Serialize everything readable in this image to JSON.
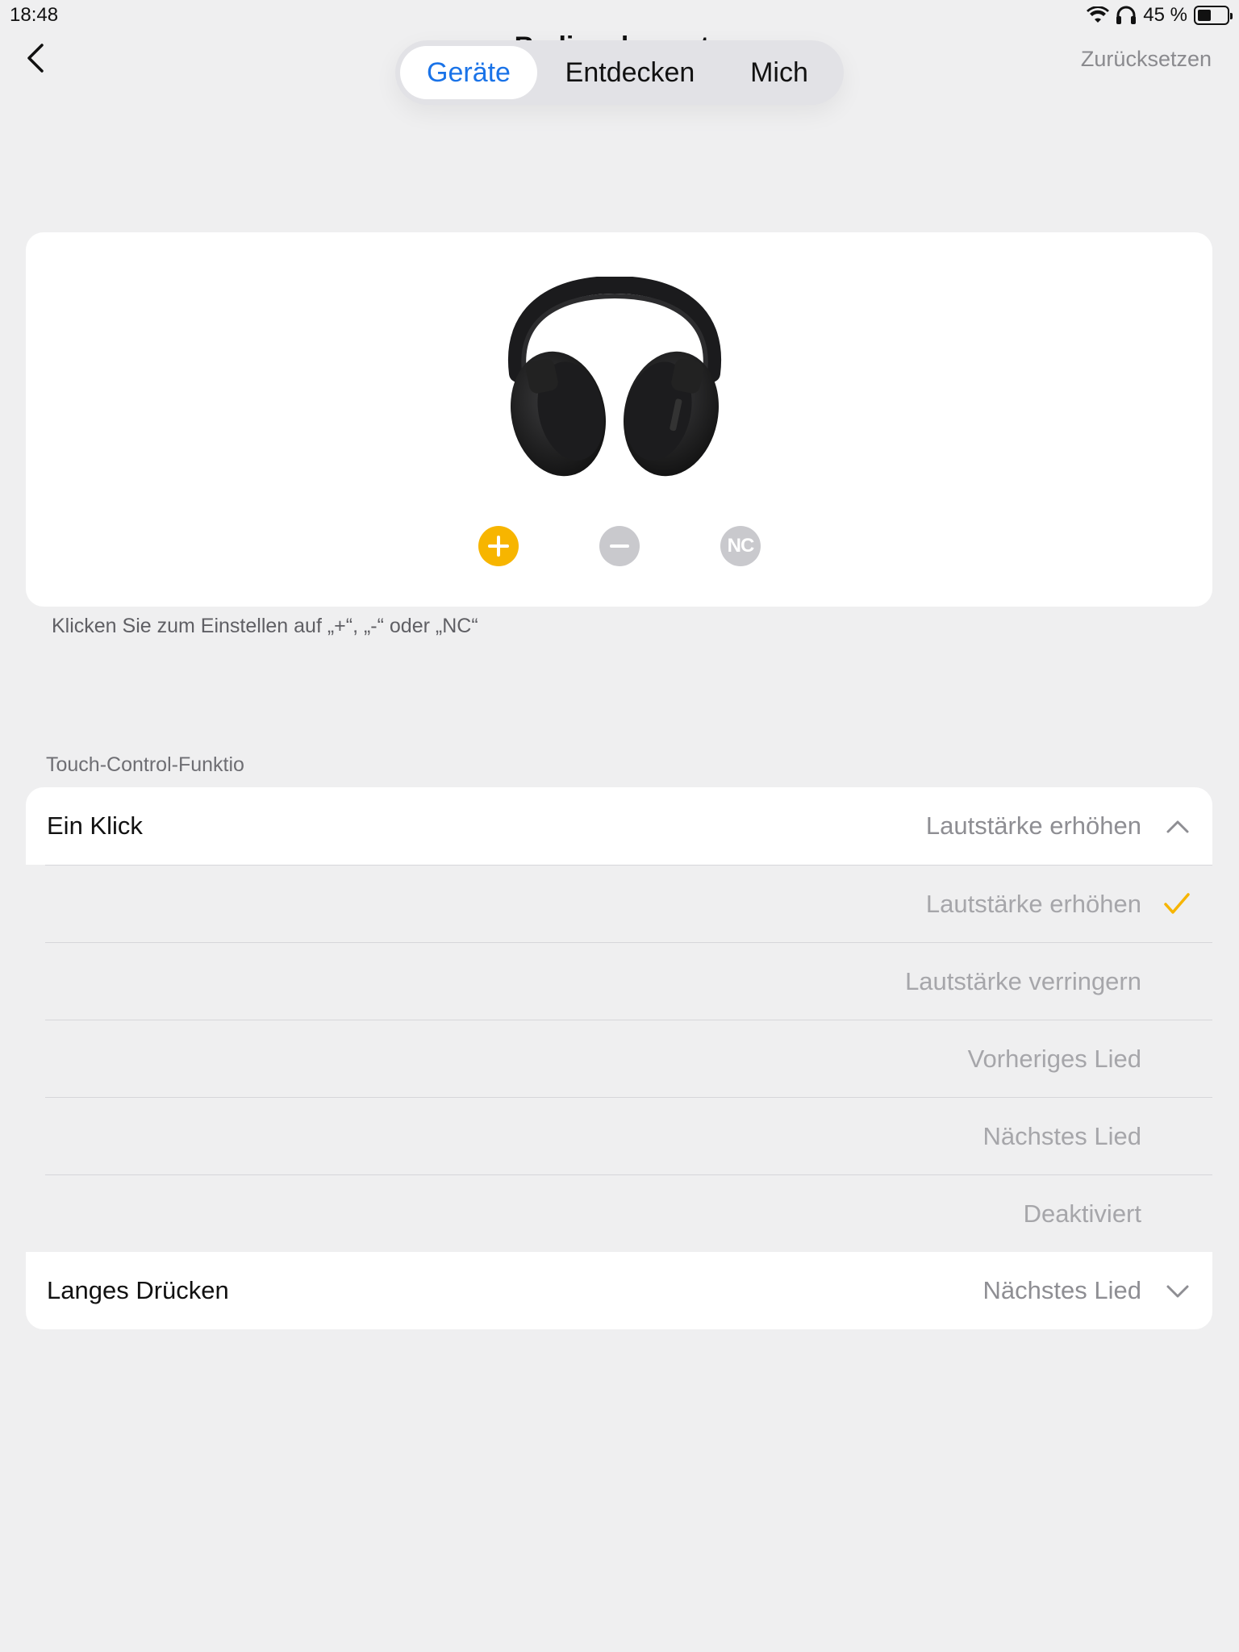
{
  "status": {
    "time": "18:48",
    "battery_text": "45 %",
    "battery_level": 0.45
  },
  "nav": {
    "title": "Bedienelemente",
    "reset_label": "Zurücksetzen",
    "tabs": [
      {
        "label": "Geräte",
        "active": true
      },
      {
        "label": "Entdecken",
        "active": false
      },
      {
        "label": "Mich",
        "active": false
      }
    ]
  },
  "device": {
    "controls": [
      {
        "label": "+",
        "icon": "plus-icon",
        "active": true
      },
      {
        "label": "−",
        "icon": "minus-icon",
        "active": false
      },
      {
        "label": "NC",
        "icon": "nc-icon",
        "active": false
      }
    ],
    "hint": "Klicken Sie zum Einstellen auf „+“, „-“ oder „NC“"
  },
  "touch_control": {
    "header": "Touch-Control-Funktio",
    "single_click": {
      "label": "Ein Klick",
      "value": "Lautstärke erhöhen",
      "expanded": true
    },
    "options": [
      {
        "label": "Lautstärke erhöhen",
        "selected": true
      },
      {
        "label": "Lautstärke verringern",
        "selected": false
      },
      {
        "label": "Vorheriges Lied",
        "selected": false
      },
      {
        "label": "Nächstes Lied",
        "selected": false
      },
      {
        "label": "Deaktiviert",
        "selected": false
      }
    ],
    "long_press": {
      "label": "Langes Drücken",
      "value": "Nächstes Lied",
      "expanded": false
    }
  },
  "colors": {
    "accent_blue": "#1a73e8",
    "accent_yellow": "#f7b500",
    "background": "#efeff0"
  }
}
